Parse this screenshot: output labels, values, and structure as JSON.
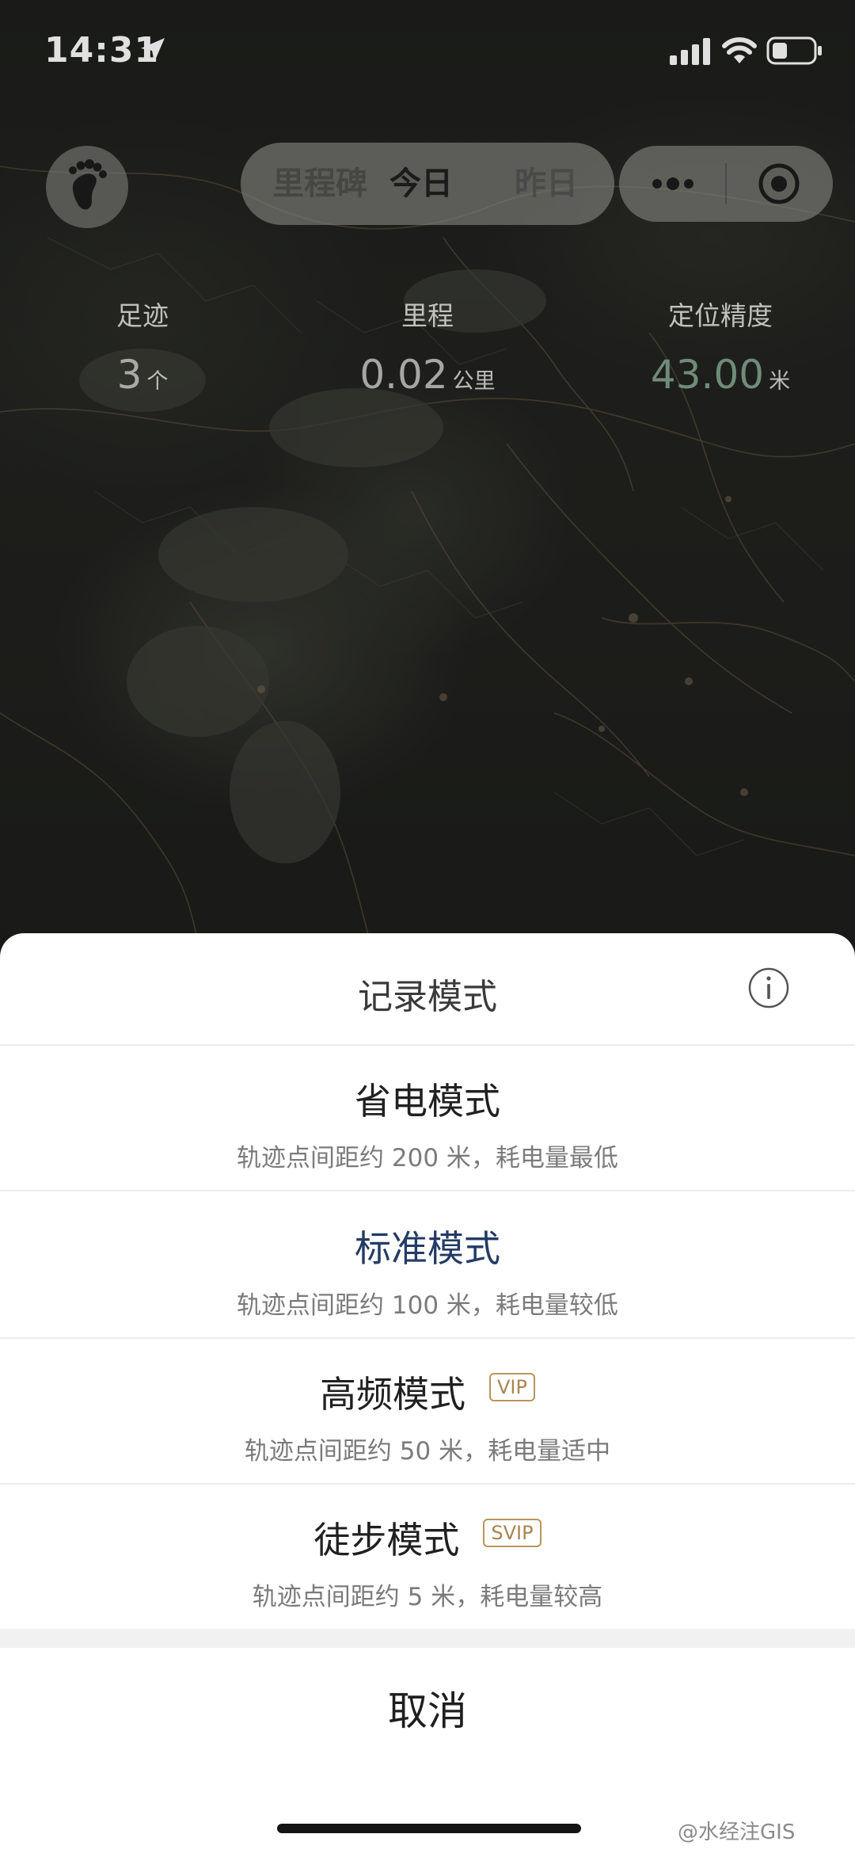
{
  "status_bar": {
    "time": "14:31"
  },
  "top_bar": {
    "tabs": [
      {
        "label": "里程碑"
      },
      {
        "label": "今日"
      },
      {
        "label": "昨日"
      }
    ]
  },
  "stats": {
    "footprint": {
      "label": "足迹",
      "value": "3",
      "unit": "个"
    },
    "mileage": {
      "label": "里程",
      "value": "0.02",
      "unit": "公里"
    },
    "accuracy": {
      "label": "定位精度",
      "value": "43.00",
      "unit": "米"
    }
  },
  "sheet": {
    "title": "记录模式",
    "options": [
      {
        "title": "省电模式",
        "description": "轨迹点间距约 200 米，耗电量最低",
        "badge": ""
      },
      {
        "title": "标准模式",
        "description": "轨迹点间距约 100 米，耗电量较低",
        "badge": ""
      },
      {
        "title": "高频模式",
        "description": "轨迹点间距约 50 米，耗电量适中",
        "badge": "VIP"
      },
      {
        "title": "徒步模式",
        "description": "轨迹点间距约 5 米，耗电量较高",
        "badge": "SVIP"
      }
    ],
    "cancel": "取消"
  },
  "watermark": "@水经注GIS",
  "colors": {
    "selected_mode": "#243b66",
    "badge": "#b8955a",
    "accuracy_value": "#7fa08a"
  },
  "icons": [
    "location-arrow-icon",
    "signal-icon",
    "wifi-icon",
    "battery-icon",
    "footprint-icon",
    "more-icon",
    "target-icon",
    "info-icon"
  ]
}
